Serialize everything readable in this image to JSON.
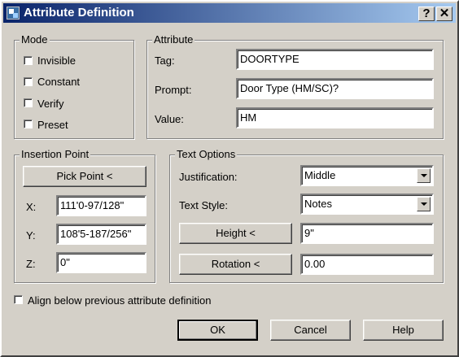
{
  "window": {
    "title": "Attribute Definition",
    "help_glyph": "?",
    "close_glyph": "✕"
  },
  "mode": {
    "title": "Mode",
    "items": [
      {
        "label": "Invisible",
        "checked": false
      },
      {
        "label": "Constant",
        "checked": false
      },
      {
        "label": "Verify",
        "checked": false
      },
      {
        "label": "Preset",
        "checked": false
      }
    ]
  },
  "attribute": {
    "title": "Attribute",
    "tag_label": "Tag:",
    "tag_value": "DOORTYPE",
    "prompt_label": "Prompt:",
    "prompt_value": "Door Type (HM/SC)?",
    "value_label": "Value:",
    "value_value": "HM"
  },
  "insertion": {
    "title": "Insertion Point",
    "pick_button": "Pick Point <",
    "x_label": "X:",
    "x_value": "111'0-97/128\"",
    "y_label": "Y:",
    "y_value": "108'5-187/256\"",
    "z_label": "Z:",
    "z_value": "0\""
  },
  "text_options": {
    "title": "Text Options",
    "justification_label": "Justification:",
    "justification_value": "Middle",
    "style_label": "Text Style:",
    "style_value": "Notes",
    "height_button": "Height <",
    "height_value": "9\"",
    "rotation_button": "Rotation <",
    "rotation_value": "0.00"
  },
  "align": {
    "label": "Align below previous attribute definition",
    "checked": false
  },
  "buttons": {
    "ok": "OK",
    "cancel": "Cancel",
    "help": "Help"
  },
  "colors": {
    "face": "#d4d0c8",
    "title_start": "#0a246a",
    "title_end": "#a6caf0"
  }
}
